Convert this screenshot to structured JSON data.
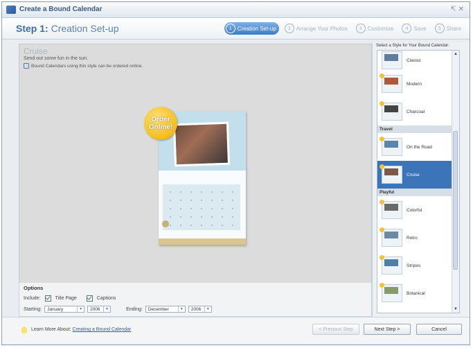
{
  "window": {
    "title": "Create a Bound Calendar",
    "controls": "↸ ✕"
  },
  "header": {
    "step_label": "Step 1:",
    "step_name": "Creation Set-up",
    "steps": [
      {
        "num": "1",
        "label": "Creation Set-up",
        "active": true
      },
      {
        "num": "2",
        "label": "Arrange Your Photos",
        "active": false
      },
      {
        "num": "3",
        "label": "Customize",
        "active": false
      },
      {
        "num": "4",
        "label": "Save",
        "active": false
      },
      {
        "num": "5",
        "label": "Share",
        "active": false
      }
    ]
  },
  "main": {
    "style_name": "Cruise",
    "description": "Send out some fun in the sun.",
    "order_note": "Bound Calendars using this style can be ordered online.",
    "badge_line1": "Order",
    "badge_line2": "Online!"
  },
  "options": {
    "title": "Options",
    "include_label": "Include:",
    "title_page_label": "Title Page",
    "title_page_checked": true,
    "captions_label": "Captions",
    "captions_checked": true,
    "starting_label": "Starting:",
    "start_month": "January",
    "start_year": "2006",
    "ending_label": "Ending:",
    "end_month": "December",
    "end_year": "2006"
  },
  "sidebar": {
    "title": "Select a Style for Your Bound Calendar:",
    "items": [
      {
        "label": "Classic"
      },
      {
        "label": "Modern"
      },
      {
        "label": "Charcoal"
      },
      {
        "category": "Travel"
      },
      {
        "label": "On the Road"
      },
      {
        "label": "Cruise",
        "selected": true
      },
      {
        "category": "Playful"
      },
      {
        "label": "Colorful"
      },
      {
        "label": "Retro"
      },
      {
        "label": "Stripes"
      },
      {
        "label": "Botanical"
      }
    ]
  },
  "footer": {
    "learn_prefix": "Learn More About:",
    "learn_link": "Creating a Bound Calendar",
    "prev_button": "< Previous Step",
    "next_button": "Next Step >",
    "cancel_button": "Cancel"
  },
  "colors": {
    "accent": "#3b74b8",
    "badge": "#f3bc1a"
  }
}
